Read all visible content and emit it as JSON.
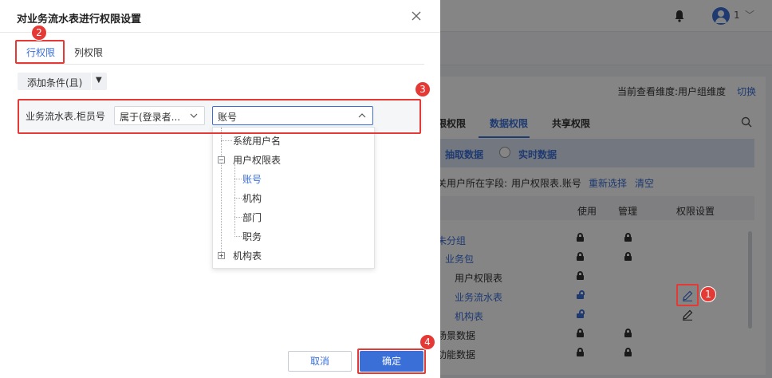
{
  "background": {
    "user_count": "1",
    "view_dimension_text": "当前查看维度:用户组维度",
    "switch_link": "切换",
    "tabs": [
      "限权限",
      "数据权限",
      "共享权限"
    ],
    "modes": [
      "抽取数据",
      "实时数据"
    ],
    "user_field_label": "关用户所在字段:",
    "user_field_value": "用户权限表.账号",
    "reselect_link": "重新选择",
    "clear_link": "清空",
    "columns": [
      "使用",
      "管理",
      "权限设置"
    ],
    "tree": [
      {
        "label": "未分组"
      },
      {
        "label": "业务包"
      },
      {
        "label": "用户权限表"
      },
      {
        "label": "业务流水表"
      },
      {
        "label": "机构表"
      },
      {
        "label": "场景数据"
      },
      {
        "label": "功能数据"
      }
    ]
  },
  "dialog": {
    "title": "对业务流水表进行权限设置",
    "tabs": {
      "row": "行权限",
      "column": "列权限"
    },
    "add_condition": "添加条件(且)",
    "condition": {
      "field": "业务流水表.柜员号",
      "operator": "属于(登录者...",
      "value": "账号"
    },
    "dropdown": {
      "items": [
        "系统用户名",
        "用户权限表",
        "账号",
        "机构",
        "部门",
        "职务",
        "机构表"
      ]
    },
    "buttons": {
      "cancel": "取消",
      "ok": "确定"
    }
  },
  "annotations": [
    "1",
    "2",
    "3",
    "4"
  ],
  "colors": {
    "accent": "#3a6fd8",
    "highlight": "#e53935",
    "overlay": "rgba(0,0,0,0.48)"
  }
}
